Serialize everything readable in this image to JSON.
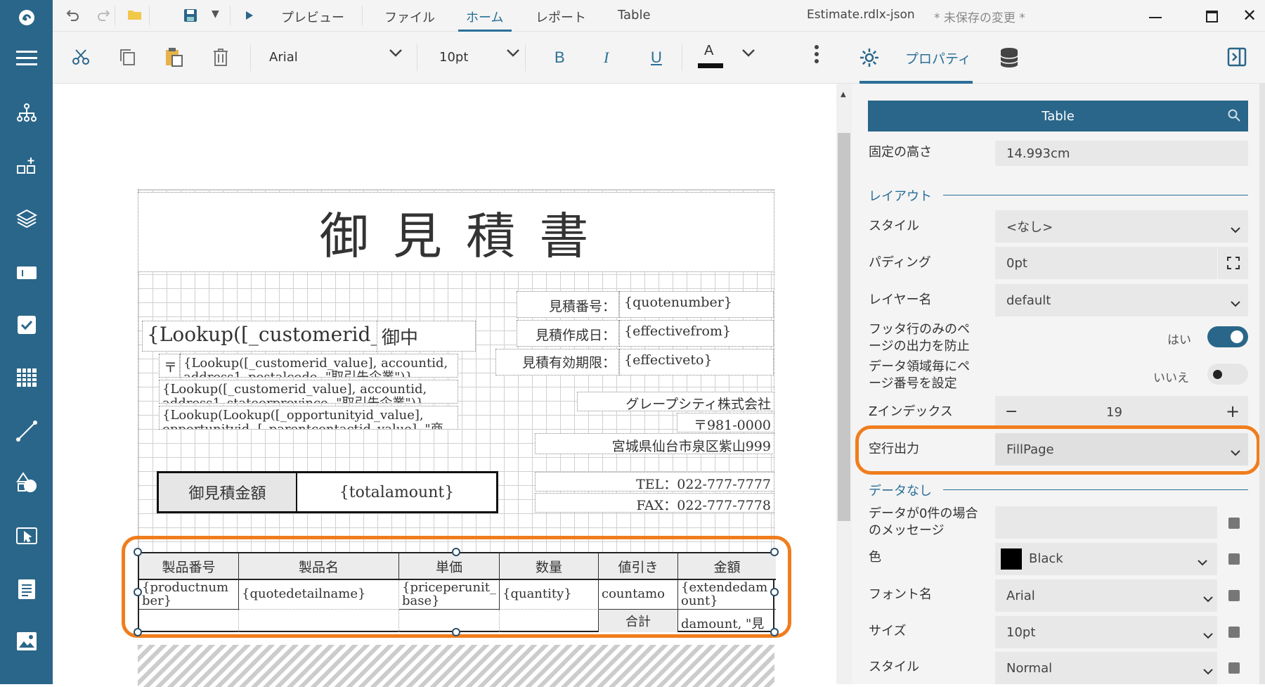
{
  "titlebar": {
    "preview_label": "プレビュー",
    "menu_tabs": [
      "ファイル",
      "ホーム",
      "レポート",
      "Table"
    ],
    "active_tab_index": 1,
    "file_name": "Estimate.rdlx-json",
    "unsaved": "* 未保存の変更 *"
  },
  "toolbar": {
    "font_name": "Arial",
    "font_size": "10pt",
    "bold": "B",
    "italic": "I",
    "underline": "U",
    "font_color_letter": "A",
    "properties_tab": "プロパティ"
  },
  "report": {
    "title": "御 見 積 書",
    "customer_lookup": "{Lookup([_customerid_v",
    "honorific": "御中",
    "postal_mark": "〒",
    "address_line1": "{Lookup([_customerid_value], accountid, address1_postalcode, \"取引先企業\")}",
    "address_line2": "{Lookup([_customerid_value], accountid, address1_stateorprovince, \"取引先企業\")}",
    "address_line3": "{Lookup(Lookup([_opportunityid_value], opportunityid, [_parentcontactid_value], \"商",
    "quote_no_label": "見積番号：",
    "quote_no_value": "{quotenumber}",
    "created_label": "見積作成日：",
    "created_value": "{effectivefrom}",
    "valid_label": "見積有効期限：",
    "valid_value": "{effectiveto}",
    "company": "グレープシティ株式会社",
    "postal_code": "〒981-0000",
    "address": "宮城県仙台市泉区紫山999",
    "tel": "TEL：022-777-7777",
    "fax": "FAX：022-777-7778",
    "total_label": "御見積金額",
    "total_value": "{totalamount}"
  },
  "table": {
    "headers": [
      "製品番号",
      "製品名",
      "単価",
      "数量",
      "値引き",
      "金額"
    ],
    "detail": [
      "{productnumber}",
      "{quotedetailname}",
      "{priceperunit_base}",
      "{quantity}",
      "{manualdiscountamount}",
      "{extendedamount}"
    ],
    "detail_display": [
      "{productnum\nber}",
      "{quotedetailname}",
      "{priceperunit_\nbase}",
      "{quantity}",
      "countamo",
      "{extendedam\nount}"
    ],
    "footer_label": "合計",
    "footer_value": "damount, \"見"
  },
  "properties": {
    "selected_item": "Table",
    "fixed_height_label": "固定の高さ",
    "fixed_height_value": "14.993cm",
    "section_layout": "レイアウト",
    "style_label": "スタイル",
    "style_value": "<なし>",
    "padding_label": "パディング",
    "padding_value": "0pt",
    "layer_label": "レイヤー名",
    "layer_value": "default",
    "prevent_footer_label": "フッタ行のみのページの出力を防止",
    "prevent_footer_value": "はい",
    "page_number_label": "データ領域毎にページ番号を設定",
    "page_number_value": "いいえ",
    "zindex_label": "Zインデックス",
    "zindex_value": "19",
    "blank_rows_label": "空行出力",
    "blank_rows_value": "FillPage",
    "section_nodata": "データなし",
    "nodata_msg_label": "データが0件の場合のメッセージ",
    "color_label": "色",
    "color_value": "Black",
    "font_name_label": "フォント名",
    "font_name_value": "Arial",
    "size_label": "サイズ",
    "size_value": "10pt",
    "style2_label": "スタイル",
    "style2_value": "Normal"
  },
  "colors": {
    "rail": "#2a6689",
    "accent": "#2a6f97",
    "highlight": "#f07d1d",
    "toggle_on": "#2a6689"
  },
  "icons": [
    "app-logo-icon",
    "menu-icon",
    "hierarchy-icon",
    "add-widget-icon",
    "layers-icon",
    "textbox-icon",
    "checkbox-icon",
    "table-icon",
    "line-icon",
    "shapes-icon",
    "select-icon",
    "report-icon",
    "image-icon",
    "undo-icon",
    "redo-icon",
    "open-folder-icon",
    "save-icon",
    "play-icon",
    "minimize-icon",
    "maximize-icon",
    "close-icon",
    "cut-icon",
    "copy-icon",
    "paste-icon",
    "delete-icon",
    "more-icon",
    "gear-icon",
    "database-icon",
    "panel-toggle-icon",
    "search-icon"
  ]
}
